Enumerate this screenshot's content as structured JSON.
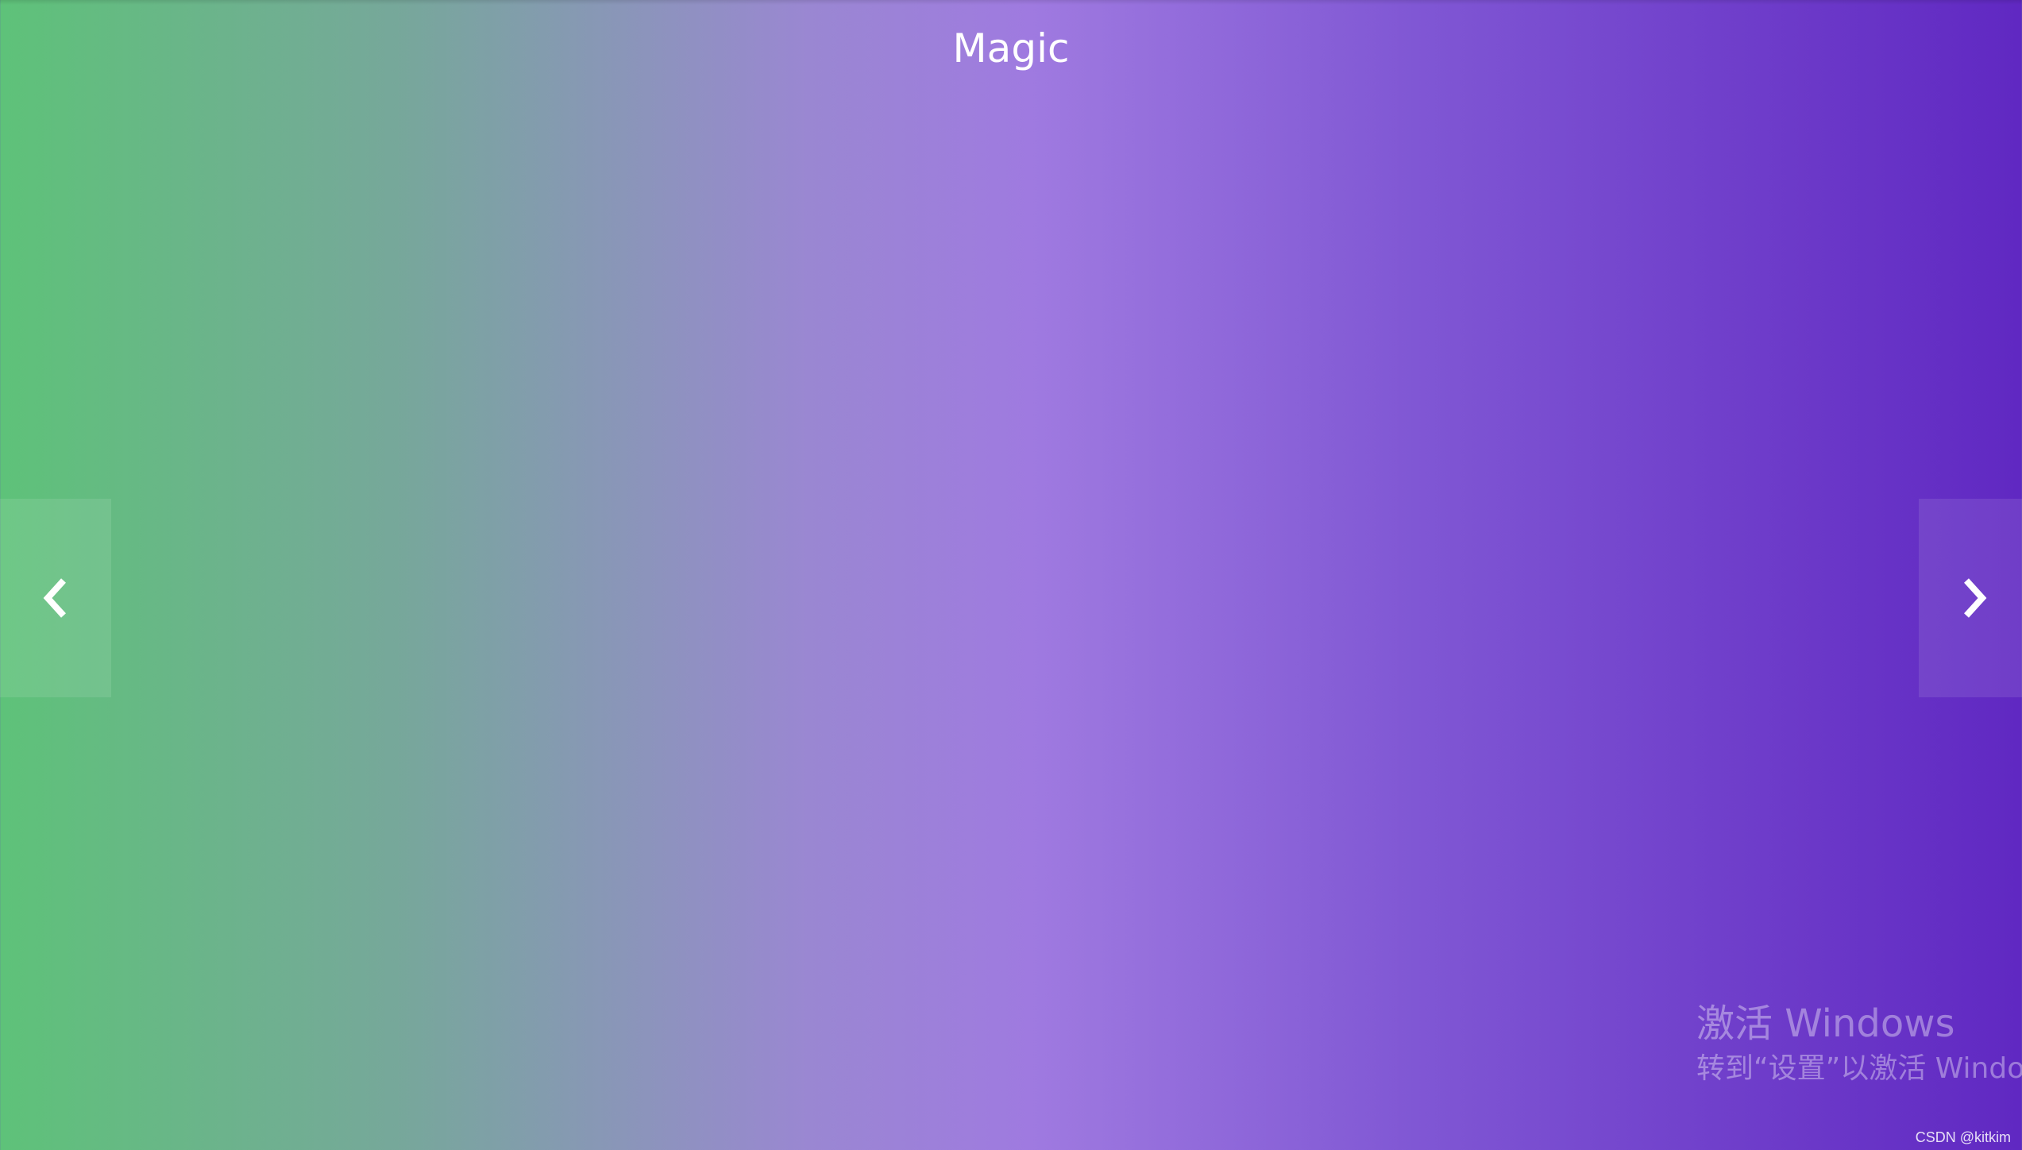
{
  "page": {
    "title": "Magic"
  },
  "carousel": {
    "prev_icon": "chevron-left-icon",
    "next_icon": "chevron-right-icon"
  },
  "watermark": {
    "line1": "激活 Windows",
    "line2": "转到“设置”以激活 Windows。"
  },
  "credit": {
    "text": "CSDN @kitkim"
  },
  "colors": {
    "gradient_start": "#5ec279",
    "gradient_mid": "#9f7ae0",
    "gradient_end": "#6028c2",
    "title_text": "#ffffff"
  }
}
